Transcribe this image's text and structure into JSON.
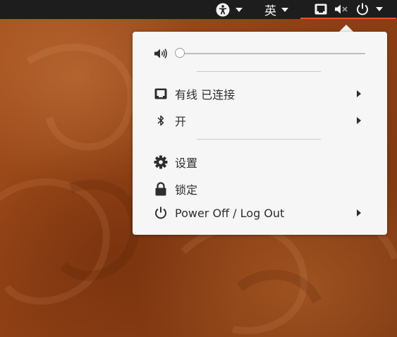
{
  "top_bar": {
    "accessibility_icon": "accessibility-icon",
    "input_method": {
      "label": "英"
    },
    "system_status_icons": [
      "wired-network-icon",
      "audio-muted-icon",
      "power-icon"
    ]
  },
  "system_menu": {
    "volume": {
      "icon": "speaker-icon",
      "level_fraction": 0.0
    },
    "items": [
      {
        "id": "wired",
        "icon": "wired-network-icon",
        "label": "有线 已连接",
        "has_submenu": true
      },
      {
        "id": "bluetooth",
        "icon": "bluetooth-icon",
        "label": "开",
        "has_submenu": true
      },
      {
        "id": "settings",
        "icon": "gear-icon",
        "label": "设置",
        "has_submenu": false
      },
      {
        "id": "lock",
        "icon": "lock-icon",
        "label": "锁定",
        "has_submenu": false
      },
      {
        "id": "power",
        "icon": "power-icon",
        "label": "Power Off / Log Out",
        "has_submenu": true
      }
    ]
  },
  "colors": {
    "top_bar": "#1d1d1d",
    "accent": "#e95420",
    "menu_background": "#f6f6f6",
    "menu_text": "#2e2e2e",
    "desktop": "#8f4014"
  }
}
